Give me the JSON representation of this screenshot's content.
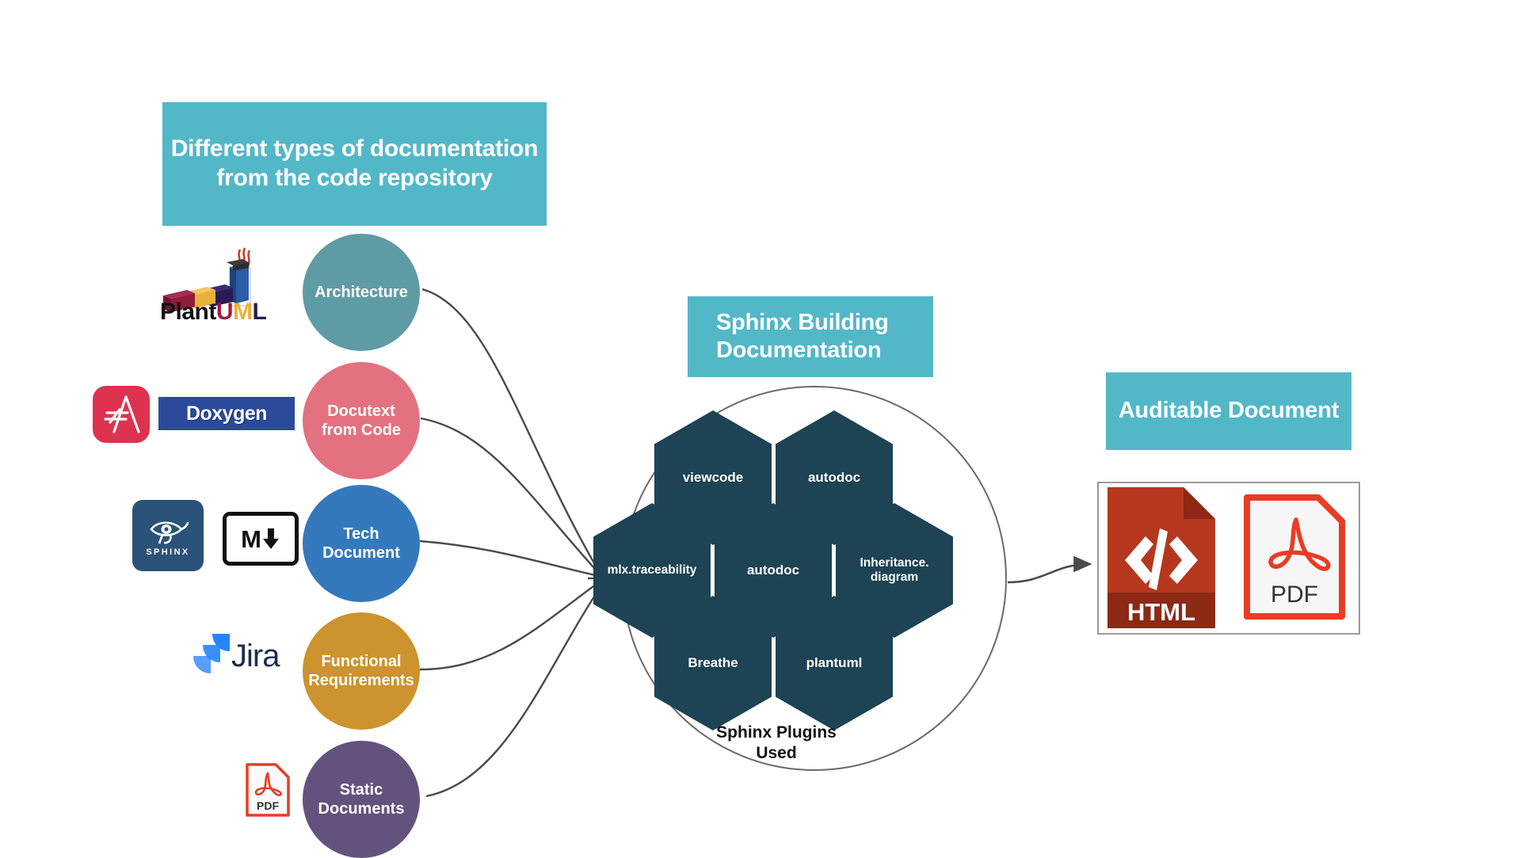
{
  "headers": {
    "left": "Different types of documentation from the code repository",
    "middle": "Sphinx Building Documentation",
    "right": "Auditable Document"
  },
  "sources": [
    {
      "label": "Architecture",
      "color": "#5f9ba4",
      "logos": [
        "plantuml-logo"
      ]
    },
    {
      "label": "Docutext from Code",
      "color": "#e4717f",
      "logos": [
        "antora-icon",
        "doxygen-logo"
      ]
    },
    {
      "label": "Tech Document",
      "color": "#3479bc",
      "logos": [
        "sphinx-logo",
        "markdown-logo"
      ]
    },
    {
      "label": "Functional Requirements",
      "color": "#cc932f",
      "logos": [
        "jira-logo"
      ]
    },
    {
      "label": "Static Documents",
      "color": "#63527e",
      "logos": [
        "pdf-icon"
      ]
    }
  ],
  "logos": {
    "plantuml": {
      "name": "PlantUML",
      "part_plant": "Plant",
      "part_u": "U",
      "part_m": "M",
      "part_l": "L"
    },
    "doxygen": {
      "name": "Doxygen"
    },
    "sphinx": {
      "name": "SPHINX"
    },
    "markdown": {
      "name": "M"
    },
    "jira": {
      "name": "Jira"
    },
    "pdf": {
      "name": "PDF"
    }
  },
  "plugins": {
    "caption": "Sphinx Plugins Used",
    "hexes": [
      {
        "label": "viewcode"
      },
      {
        "label": "autodoc"
      },
      {
        "label": "mlx.traceability"
      },
      {
        "label": "autodoc"
      },
      {
        "label": "Inheritance. diagram"
      },
      {
        "label": "Breathe"
      },
      {
        "label": "plantuml"
      }
    ]
  },
  "outputs": [
    {
      "label": "HTML",
      "code_glyph": "</>",
      "color": "#b5371e"
    },
    {
      "label": "PDF",
      "color": "#e8402a"
    }
  ],
  "colors": {
    "teal_box": "#52b8c8",
    "hex_fill": "#1d4354",
    "connector": "#4a4a4a"
  }
}
